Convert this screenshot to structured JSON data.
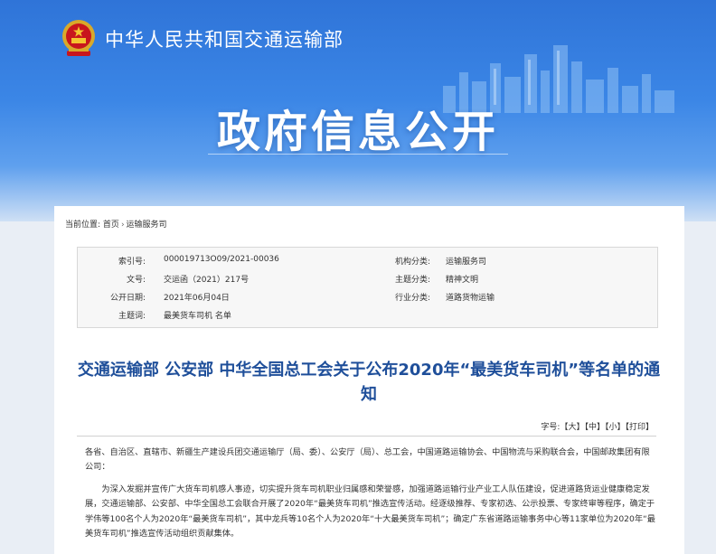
{
  "header": {
    "ministry_name": "中华人民共和国交通运输部",
    "banner_title": "政府信息公开"
  },
  "breadcrumb": {
    "label": "当前位置:",
    "home": "首页",
    "separator": "›",
    "current": "运输服务司"
  },
  "meta": {
    "index_label": "索引号:",
    "index_value": "000019713O09/2021-00036",
    "org_label": "机构分类:",
    "org_value": "运输服务司",
    "doc_label": "文号:",
    "doc_value": "交运函（2021）217号",
    "topic_label": "主题分类:",
    "topic_value": "精神文明",
    "date_label": "公开日期:",
    "date_value": "2021年06月04日",
    "industry_label": "行业分类:",
    "industry_value": "道路货物运输",
    "subject_label": "主题词:",
    "subject_value": "最美货车司机 名单"
  },
  "document": {
    "title": "交通运输部 公安部 中华全国总工会关于公布2020年“最美货车司机”等名单的通知",
    "font_label": "字号:",
    "font_large": "【大】",
    "font_medium": "【中】",
    "font_small": "【小】",
    "print": "【打印】",
    "salutation": "各省、自治区、直辖市、新疆生产建设兵团交通运输厅（局、委）、公安厅（局）、总工会，中国道路运输协会、中国物流与采购联合会，中国邮政集团有限公司：",
    "paragraph1": "为深入发掘并宣传广大货车司机感人事迹，切实提升货车司机职业归属感和荣誉感，加强道路运输行业产业工人队伍建设，促进道路货运业健康稳定发展，交通运输部、公安部、中华全国总工会联合开展了2020年“最美货车司机”推选宣传活动。经逐级推荐、专家初选、公示投票、专家终审等程序，确定于学伟等100名个人为2020年“最美货车司机”，其中龙兵等10名个人为2020年“十大最美货车司机”；确定广东省道路运输事务中心等11家单位为2020年“最美货车司机”推选宣传活动组织贡献集体。"
  },
  "colors": {
    "banner_blue": "#3b86e6",
    "title_blue": "#1f4f9a"
  }
}
